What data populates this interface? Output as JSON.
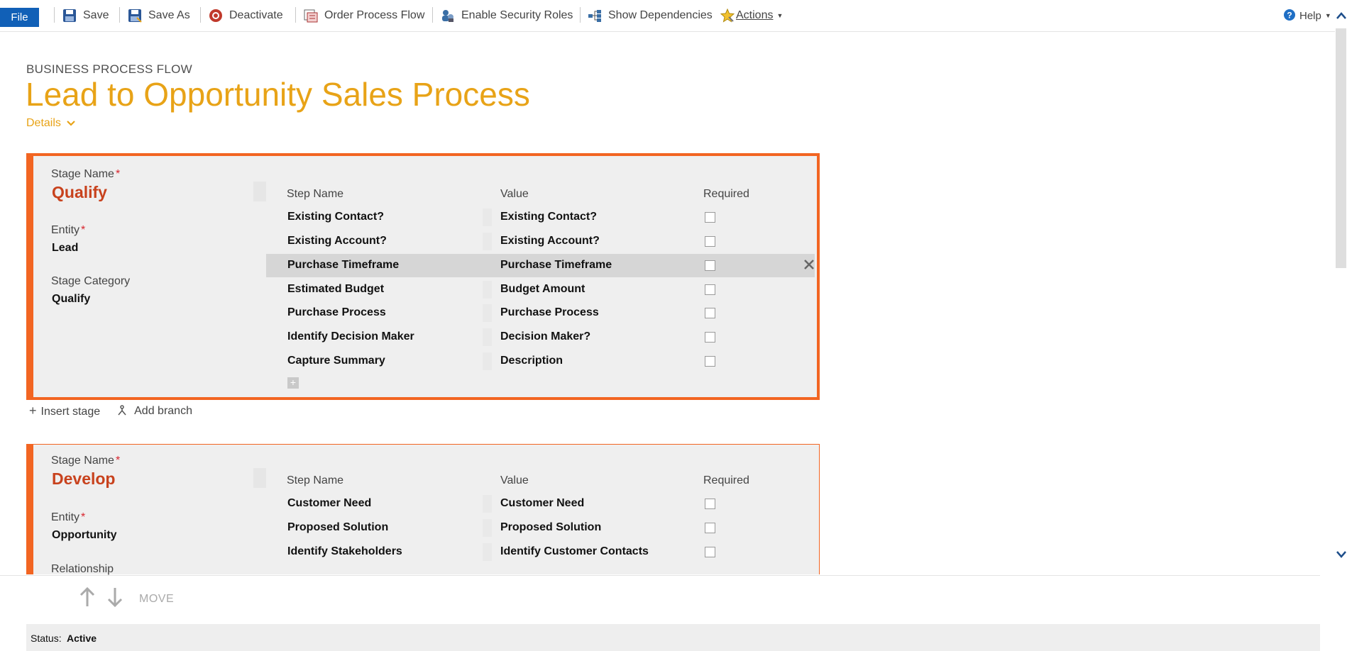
{
  "toolbar": {
    "file": "File",
    "save": "Save",
    "save_as": "Save As",
    "deactivate": "Deactivate",
    "order_process_flow": "Order Process Flow",
    "enable_security_roles": "Enable Security Roles",
    "show_dependencies": "Show Dependencies",
    "actions": "Actions",
    "help": "Help"
  },
  "header": {
    "entity_type": "BUSINESS PROCESS FLOW",
    "title": "Lead to Opportunity Sales Process",
    "details": "Details"
  },
  "columns": {
    "step_name": "Step Name",
    "value": "Value",
    "required": "Required"
  },
  "stages": [
    {
      "stage_name_label": "Stage Name",
      "stage_name": "Qualify",
      "entity_label": "Entity",
      "entity": "Lead",
      "category_label": "Stage Category",
      "category": "Qualify",
      "steps": [
        {
          "name": "Existing Contact?",
          "value": "Existing Contact?",
          "required": false
        },
        {
          "name": "Existing Account?",
          "value": "Existing Account?",
          "required": false
        },
        {
          "name": "Purchase Timeframe",
          "value": "Purchase Timeframe",
          "required": false,
          "selected": true
        },
        {
          "name": "Estimated Budget",
          "value": "Budget Amount",
          "required": false
        },
        {
          "name": "Purchase Process",
          "value": "Purchase Process",
          "required": false
        },
        {
          "name": "Identify Decision Maker",
          "value": "Decision Maker?",
          "required": false
        },
        {
          "name": "Capture Summary",
          "value": "Description",
          "required": false
        }
      ]
    },
    {
      "stage_name_label": "Stage Name",
      "stage_name": "Develop",
      "entity_label": "Entity",
      "entity": "Opportunity",
      "relationship_label": "Relationship",
      "steps": [
        {
          "name": "Customer Need",
          "value": "Customer Need",
          "required": false
        },
        {
          "name": "Proposed Solution",
          "value": "Proposed Solution",
          "required": false
        },
        {
          "name": "Identify Stakeholders",
          "value": "Identify Customer Contacts",
          "required": false
        }
      ]
    }
  ],
  "stage_actions": {
    "insert_stage": "Insert stage",
    "add_branch": "Add branch"
  },
  "move": {
    "label": "MOVE"
  },
  "status": {
    "label": "Status:",
    "value": "Active"
  },
  "colors": {
    "accent_orange": "#f26522",
    "title_gold": "#e8a317",
    "stage_name_red": "#c8421d",
    "file_blue": "#1160b7"
  },
  "icons": [
    "save-icon",
    "save-as-icon",
    "deactivate-icon",
    "order-process-flow-icon",
    "security-roles-icon",
    "dependencies-icon",
    "actions-icon",
    "help-icon"
  ]
}
